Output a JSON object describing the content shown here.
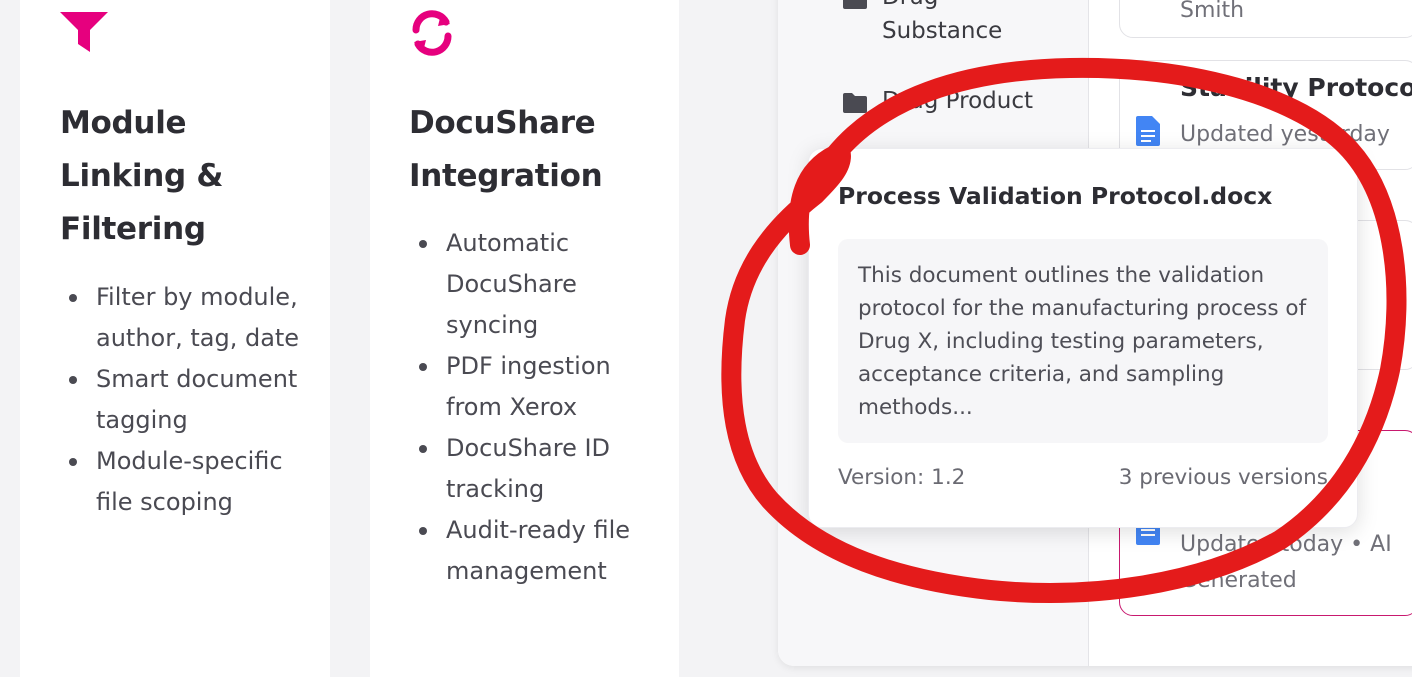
{
  "cards": [
    {
      "icon": "funnel-icon",
      "title": "Module Linking & Filtering",
      "items": [
        "Filter by module, author, tag, date",
        "Smart document tagging",
        "Module-specific file scoping"
      ]
    },
    {
      "icon": "refresh-icon",
      "title": "DocuShare Integration",
      "items": [
        "Automatic DocuShare syncing",
        "PDF ingestion from Xerox",
        "DocuShare ID tracking",
        "Audit-ready file management"
      ]
    }
  ],
  "sidebar": {
    "folders": [
      {
        "label": "Drug Substance",
        "icon": "folder-icon"
      },
      {
        "label": "Drug Product",
        "icon": "folder-icon"
      }
    ]
  },
  "documents": {
    "items": [
      {
        "title": "",
        "meta": "Smith"
      },
      {
        "title": "Stability Protocol",
        "meta": "Updated yesterday"
      },
      {
        "title": "",
        "meta": "Updated today • AI Generated"
      }
    ]
  },
  "popup": {
    "title": "Process Validation Protocol.docx",
    "description": "This document outlines the validation protocol for the manufacturing process of Drug X, including testing parameters, acceptance criteria, and sampling methods...",
    "version": "Version: 1.2",
    "previous_versions": "3 previous versions"
  },
  "colors": {
    "accent_magenta": "#e6007e",
    "doc_icon_blue": "#4285f4",
    "annotation_red": "#e41b1b"
  }
}
